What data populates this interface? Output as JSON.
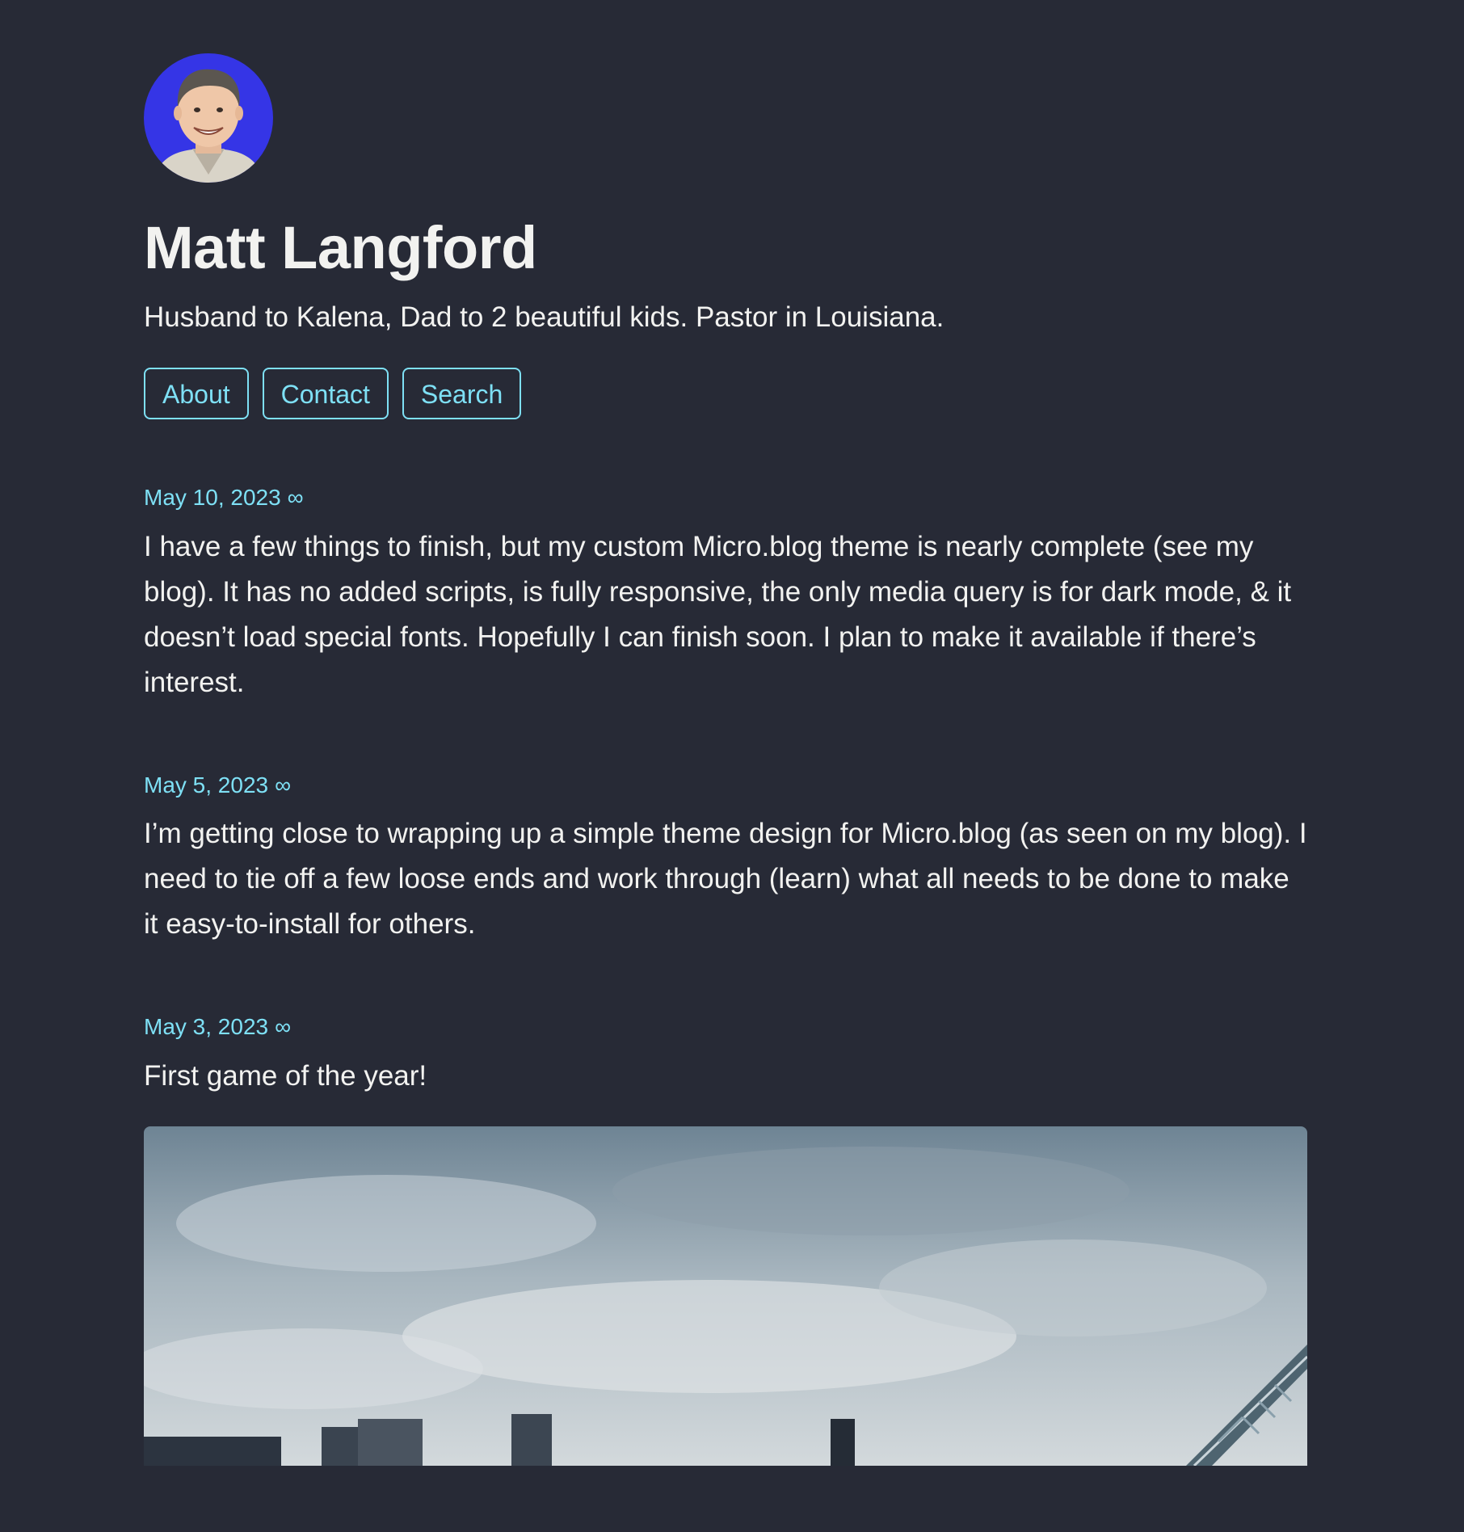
{
  "site": {
    "title": "Matt Langford",
    "tagline": "Husband to Kalena, Dad to 2 beautiful kids. Pastor in Louisiana."
  },
  "nav": {
    "about": "About",
    "contact": "Contact",
    "search": "Search"
  },
  "posts": [
    {
      "date": "May 10, 2023",
      "permalink": "∞",
      "text": "I have a few things to finish, but my custom Micro.blog theme is nearly complete (see my blog). It has no added scripts, is fully responsive, the only media query is for dark mode, & it doesn’t load special fonts. Hopefully I can finish soon. I plan to make it available if there’s interest."
    },
    {
      "date": "May 5, 2023",
      "permalink": "∞",
      "text": "I’m getting close to wrapping up a simple theme design for Micro.blog (as seen on my blog). I need to tie off a few loose ends and work through (learn) what all needs to be done to make it easy-to-install for others."
    },
    {
      "date": "May 3, 2023",
      "permalink": "∞",
      "text": "First game of the year!"
    }
  ],
  "colors": {
    "background": "#272a36",
    "accent": "#7ee0f5",
    "text": "#f2f2f0",
    "avatar_bg": "#3535e6"
  }
}
